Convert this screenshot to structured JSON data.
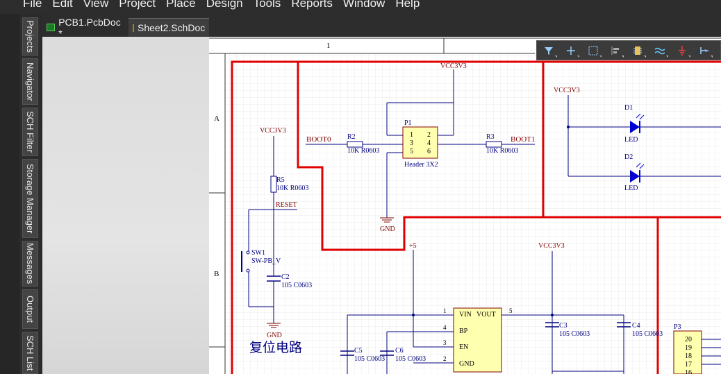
{
  "menu": [
    "File",
    "Edit",
    "View",
    "Project",
    "Place",
    "Design",
    "Tools",
    "Reports",
    "Window",
    "Help"
  ],
  "side_tabs": [
    "Projects",
    "Navigator",
    "SCH Filter",
    "Storage Manager",
    "Messages",
    "Output",
    "SCH List"
  ],
  "doc_tabs": [
    {
      "label": "PCB1.PcbDoc *",
      "icon": "pcb-doc-icon"
    },
    {
      "label": "Sheet2.SchDoc",
      "icon": "sch-doc-icon"
    }
  ],
  "toolbar_icons": [
    "filter-icon",
    "crosshair-icon",
    "select-rect-icon",
    "align-icon",
    "component-icon",
    "wire-icon",
    "power-port-icon",
    "bus-entry-icon"
  ],
  "schematic": {
    "col_marker": "1",
    "row_markers": [
      "A",
      "B"
    ],
    "vcc_labels": [
      "VCC3V3",
      "VCC3V3",
      "VCC3V3",
      "VCC3V3"
    ],
    "plus5": "+5",
    "gnd_labels": [
      "GND",
      "GND"
    ],
    "boot0": "BOOT0",
    "boot1": "BOOT1",
    "reset": "RESET",
    "r2": {
      "ref": "R2",
      "val": "10K R0603"
    },
    "r3": {
      "ref": "R3",
      "val": "10K R0603"
    },
    "r5": {
      "ref": "R5",
      "val": "10K R0603"
    },
    "p1": {
      "ref": "P1",
      "name": "Header 3X2",
      "pins": [
        "1",
        "2",
        "3",
        "4",
        "5",
        "6"
      ]
    },
    "sw1": {
      "ref": "SW1",
      "val": "SW-PB_V"
    },
    "c2": {
      "ref": "C2",
      "val": "105 C0603"
    },
    "c3": {
      "ref": "C3",
      "val": "105 C0603"
    },
    "c4": {
      "ref": "C4",
      "val": "105 C0603"
    },
    "c5": {
      "ref": "C5",
      "val": "105 C0603"
    },
    "c6": {
      "ref": "C6",
      "val": "105 C0603"
    },
    "d1": {
      "ref": "D1",
      "val": "LED"
    },
    "d2": {
      "ref": "D2",
      "val": "LED"
    },
    "reg": {
      "pins_left": [
        "VIN",
        "BP",
        "EN",
        "GND"
      ],
      "pin_right": "VOUT",
      "pin_nums": [
        "1",
        "4",
        "3",
        "2",
        "5"
      ]
    },
    "p3": {
      "ref": "P3",
      "pins": [
        "20",
        "19",
        "18",
        "17",
        "16"
      ]
    },
    "reset_title": "复位电路"
  },
  "colors": {
    "wire": "#000080",
    "label": "#800000",
    "border": "#e00000",
    "comp_fill": "#ffffb0",
    "led": "#0000d0"
  }
}
